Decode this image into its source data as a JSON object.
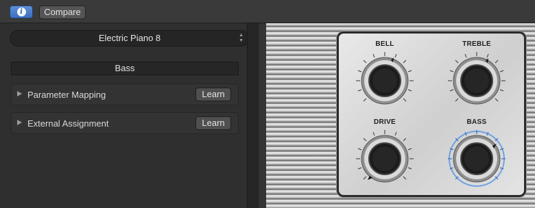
{
  "toolbar": {
    "info_icon": "info-icon",
    "compare_label": "Compare"
  },
  "preset": {
    "name": "Electric Piano 8",
    "arrows_icon": "up-down-arrows-icon"
  },
  "panel": {
    "section_title": "Bass",
    "rows": [
      {
        "label": "Parameter Mapping",
        "button": "Learn"
      },
      {
        "label": "External Assignment",
        "button": "Learn"
      }
    ]
  },
  "knobs": [
    {
      "label": "BELL"
    },
    {
      "label": "TREBLE"
    },
    {
      "label": "DRIVE"
    },
    {
      "label": "BASS",
      "selected": true,
      "highlight_color": "#4a8ee8"
    }
  ],
  "colors": {
    "accent": "#3b6fbf"
  }
}
